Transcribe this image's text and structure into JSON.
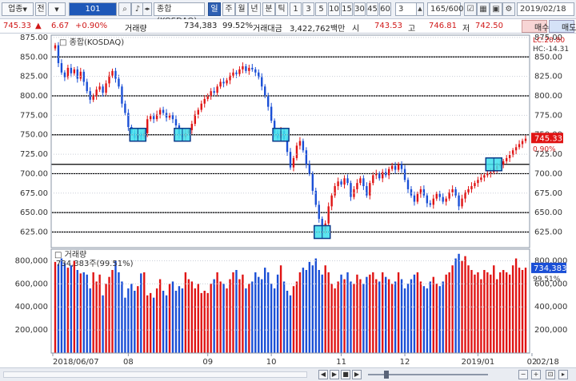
{
  "toolbar": {
    "category": "업종",
    "dropdown_mark": "▼",
    "market": "전",
    "code": "101",
    "index_name": "종합(KOSDAQ)",
    "period_buttons": [
      "일",
      "주",
      "월",
      "년",
      "분",
      "틱"
    ],
    "interval_buttons": [
      "1",
      "3",
      "5",
      "10",
      "15",
      "30",
      "45",
      "60"
    ],
    "interval_value": "3",
    "count": "165/600",
    "date": "2019/02/18"
  },
  "quote": {
    "price": "745.33",
    "change_arrow": "▲",
    "change": "6.67",
    "change_pct": "+0.90%",
    "volume_label": "거래량",
    "volume": "734,383",
    "volume_ratio": "99.52%",
    "amount_label": "거래대금",
    "amount": "3,422,762백만",
    "open_label": "시",
    "open": "743.53",
    "high_label": "고",
    "high": "746.81",
    "low_label": "저",
    "low": "742.50",
    "buy_label": "매수",
    "sell_label": "매도"
  },
  "chart_data": [
    {
      "type": "candlestick",
      "title": "종합(KOSDAQ)",
      "y_ticks": [
        "875.00",
        "850.00",
        "825.00",
        "800.00",
        "775.00",
        "750.00",
        "725.00",
        "700.00",
        "675.00",
        "650.00",
        "625.00"
      ],
      "right_y_ticks": [
        "875.00",
        "850.00",
        "825.00",
        "800.00",
        "775.00",
        "750.00",
        "725.00",
        "700.00",
        "675.00",
        "650.00",
        "625.00"
      ],
      "ylim": [
        605,
        878
      ],
      "x_tick_labels": [
        "2018/06/07",
        "08",
        "09",
        "10",
        "11",
        "12",
        "2019/01",
        "02"
      ],
      "last_date_label": "02/18",
      "range_labels": [
        "LC:20.80",
        "HC:-14.31"
      ],
      "current_price_label": "745.33",
      "current_change_label": "0.90%",
      "horizontal_lines": [
        850,
        800,
        750,
        712,
        700,
        650,
        625
      ],
      "highlight_boxes": [
        {
          "index": 26,
          "price": 750
        },
        {
          "index": 40,
          "price": 750
        },
        {
          "index": 71,
          "price": 750
        },
        {
          "index": 84,
          "price": 625
        },
        {
          "index": 138,
          "price": 712
        }
      ],
      "close": [
        865,
        842,
        830,
        824,
        836,
        829,
        834,
        822,
        831,
        818,
        806,
        795,
        800,
        808,
        812,
        804,
        816,
        826,
        832,
        822,
        812,
        790,
        778,
        760,
        752,
        746,
        750,
        748,
        752,
        770,
        774,
        770,
        776,
        782,
        778,
        772,
        775,
        770,
        762,
        750,
        747,
        752,
        756,
        764,
        776,
        782,
        790,
        796,
        800,
        806,
        804,
        812,
        818,
        816,
        820,
        826,
        830,
        828,
        834,
        838,
        832,
        836,
        834,
        830,
        824,
        812,
        800,
        786,
        768,
        752,
        746,
        755,
        744,
        728,
        708,
        720,
        736,
        742,
        730,
        712,
        700,
        678,
        660,
        642,
        628,
        636,
        658,
        672,
        684,
        690,
        686,
        694,
        688,
        670,
        680,
        688,
        694,
        684,
        672,
        688,
        698,
        700,
        694,
        702,
        698,
        706,
        710,
        705,
        712,
        706,
        692,
        680,
        672,
        664,
        674,
        680,
        672,
        662,
        660,
        668,
        674,
        670,
        664,
        668,
        676,
        680,
        672,
        658,
        668,
        676,
        680,
        684,
        688,
        692,
        695,
        698,
        700,
        702,
        706,
        710,
        712,
        716,
        720,
        724,
        730,
        734,
        738,
        742,
        745
      ],
      "volume_title": "거래량",
      "volume_info": "734,383주(99.51%)",
      "volume_ticks": [
        "800,000",
        "600,000",
        "400,000",
        "200,000"
      ],
      "volume_current_label": "734,383",
      "volume_current_pct": "99.51%",
      "volume_ylim": [
        0,
        900000
      ],
      "volume": [
        790,
        770,
        820,
        780,
        740,
        760,
        800,
        720,
        690,
        700,
        680,
        560,
        700,
        620,
        680,
        500,
        600,
        660,
        720,
        800,
        700,
        620,
        480,
        560,
        600,
        540,
        580,
        690,
        700,
        500,
        520,
        480,
        560,
        640,
        540,
        500,
        600,
        620,
        540,
        580,
        560,
        700,
        640,
        620,
        560,
        600,
        520,
        540,
        520,
        600,
        640,
        700,
        620,
        600,
        560,
        640,
        700,
        720,
        640,
        680,
        560,
        600,
        620,
        700,
        660,
        640,
        740,
        700,
        600,
        560,
        680,
        760,
        620,
        540,
        500,
        580,
        620,
        700,
        740,
        720,
        790,
        760,
        820,
        720,
        680,
        760,
        700,
        600,
        560,
        620,
        680,
        640,
        700,
        620,
        600,
        680,
        640,
        600,
        660,
        680,
        700,
        640,
        620,
        700,
        660,
        640,
        600,
        620,
        700,
        640,
        560,
        600,
        640,
        680,
        700,
        620,
        580,
        560,
        620,
        660,
        600,
        580,
        620,
        680,
        700,
        760,
        820,
        860,
        800,
        840,
        760,
        720,
        680,
        700,
        640,
        720,
        700,
        680,
        760,
        640,
        700,
        720,
        700,
        680,
        760,
        820,
        740,
        720,
        740,
        734
      ]
    }
  ],
  "status": {
    "nav_buttons": [
      "◀",
      "▶",
      "■",
      "▶"
    ]
  }
}
